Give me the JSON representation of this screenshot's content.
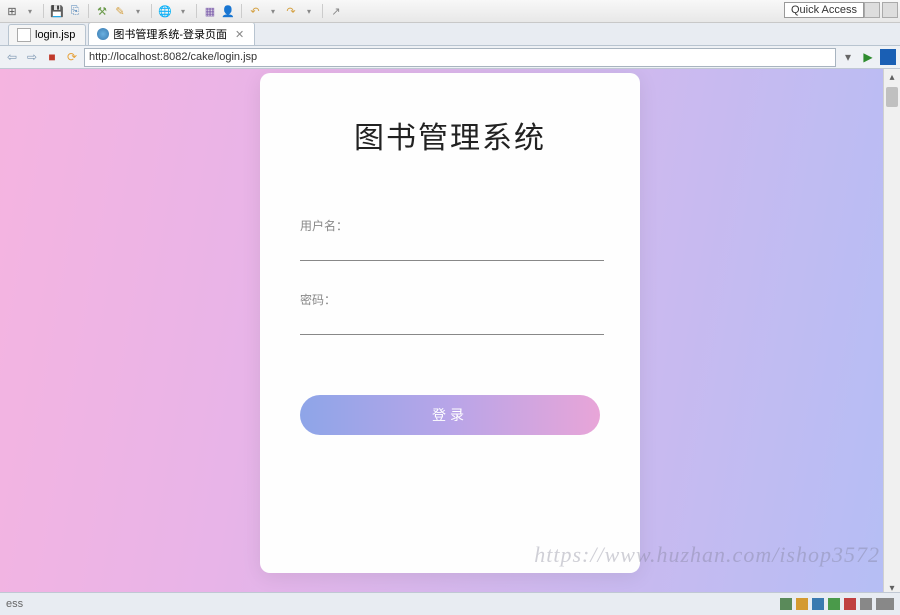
{
  "topbar": {
    "quick_access": "Quick Access"
  },
  "tabs": {
    "tab1_label": "login.jsp",
    "tab2_label": "图书管理系统-登录页面"
  },
  "address": {
    "url": "http://localhost:8082/cake/login.jsp"
  },
  "page": {
    "title": "图书管理系统",
    "username_label": "用户名：",
    "password_label": "密码：",
    "login_button": "登录"
  },
  "status": {
    "left_text": "ess"
  },
  "watermark": "https://www.huzhan.com/ishop3572"
}
